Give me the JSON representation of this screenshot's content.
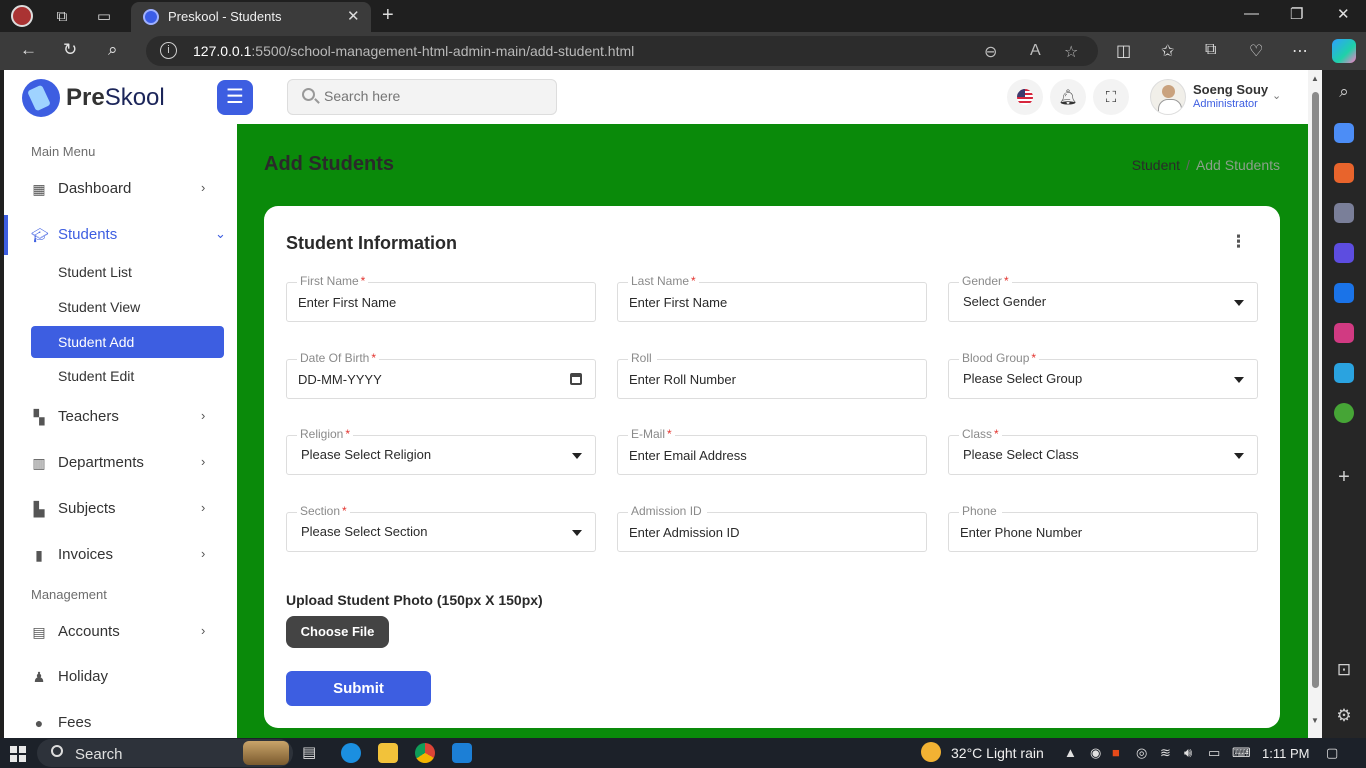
{
  "browser": {
    "tab_title": "Preskool - Students",
    "url_host": "127.0.0.1",
    "url_rest": ":5500/school-management-html-admin-main/add-student.html"
  },
  "header": {
    "logo_brand": "Pre",
    "logo_rest": "Skool",
    "search_placeholder": "Search here",
    "user_name": "Soeng Souy",
    "user_role": "Administrator"
  },
  "sidebar": {
    "main_menu_title": "Main Menu",
    "management_title": "Management",
    "items": [
      {
        "label": "Dashboard",
        "icon": "grid-icon"
      },
      {
        "label": "Students",
        "icon": "graduation-cap-icon"
      },
      {
        "label": "Teachers",
        "icon": "teacher-icon"
      },
      {
        "label": "Departments",
        "icon": "building-icon"
      },
      {
        "label": "Subjects",
        "icon": "book-icon"
      },
      {
        "label": "Invoices",
        "icon": "clipboard-icon"
      },
      {
        "label": "Accounts",
        "icon": "file-invoice-icon"
      },
      {
        "label": "Holiday",
        "icon": "holiday-icon"
      },
      {
        "label": "Fees",
        "icon": "coin-icon"
      }
    ],
    "student_sub": [
      "Student List",
      "Student View",
      "Student Add",
      "Student Edit"
    ]
  },
  "page": {
    "title": "Add Students",
    "breadcrumb_parent": "Student",
    "breadcrumb_sep": "/",
    "breadcrumb_current": "Add Students"
  },
  "form": {
    "card_title": "Student Information",
    "fields": [
      {
        "label": "First Name",
        "required": "*",
        "value": "Enter First Name",
        "type": "text"
      },
      {
        "label": "Last Name",
        "required": "*",
        "value": "Enter First Name",
        "type": "text"
      },
      {
        "label": "Gender",
        "required": "*",
        "value": "Select Gender",
        "type": "select"
      },
      {
        "label": "Date Of Birth",
        "required": "*",
        "value": "DD-MM-YYYY",
        "type": "date"
      },
      {
        "label": "Roll",
        "required": "",
        "value": "Enter Roll Number",
        "type": "text"
      },
      {
        "label": "Blood Group",
        "required": "*",
        "value": "Please Select Group",
        "type": "select"
      },
      {
        "label": "Religion",
        "required": "*",
        "value": "Please Select Religion",
        "type": "select"
      },
      {
        "label": "E-Mail",
        "required": "*",
        "value": "Enter Email Address",
        "type": "text"
      },
      {
        "label": "Class",
        "required": "*",
        "value": "Please Select Class",
        "type": "select"
      },
      {
        "label": "Section",
        "required": "*",
        "value": "Please Select Section",
        "type": "select"
      },
      {
        "label": "Admission ID",
        "required": "",
        "value": "Enter Admission ID",
        "type": "text"
      },
      {
        "label": "Phone",
        "required": "",
        "value": "Enter Phone Number",
        "type": "text"
      }
    ],
    "upload_label": "Upload Student Photo (150px X 150px)",
    "choose_file": "Choose File",
    "submit": "Submit"
  },
  "taskbar": {
    "search": "Search",
    "weather": "32°C  Light rain",
    "time": "1:11 PM"
  },
  "colors": {
    "accent": "#3d5ee1",
    "content_bg": "#0a8a0a"
  }
}
